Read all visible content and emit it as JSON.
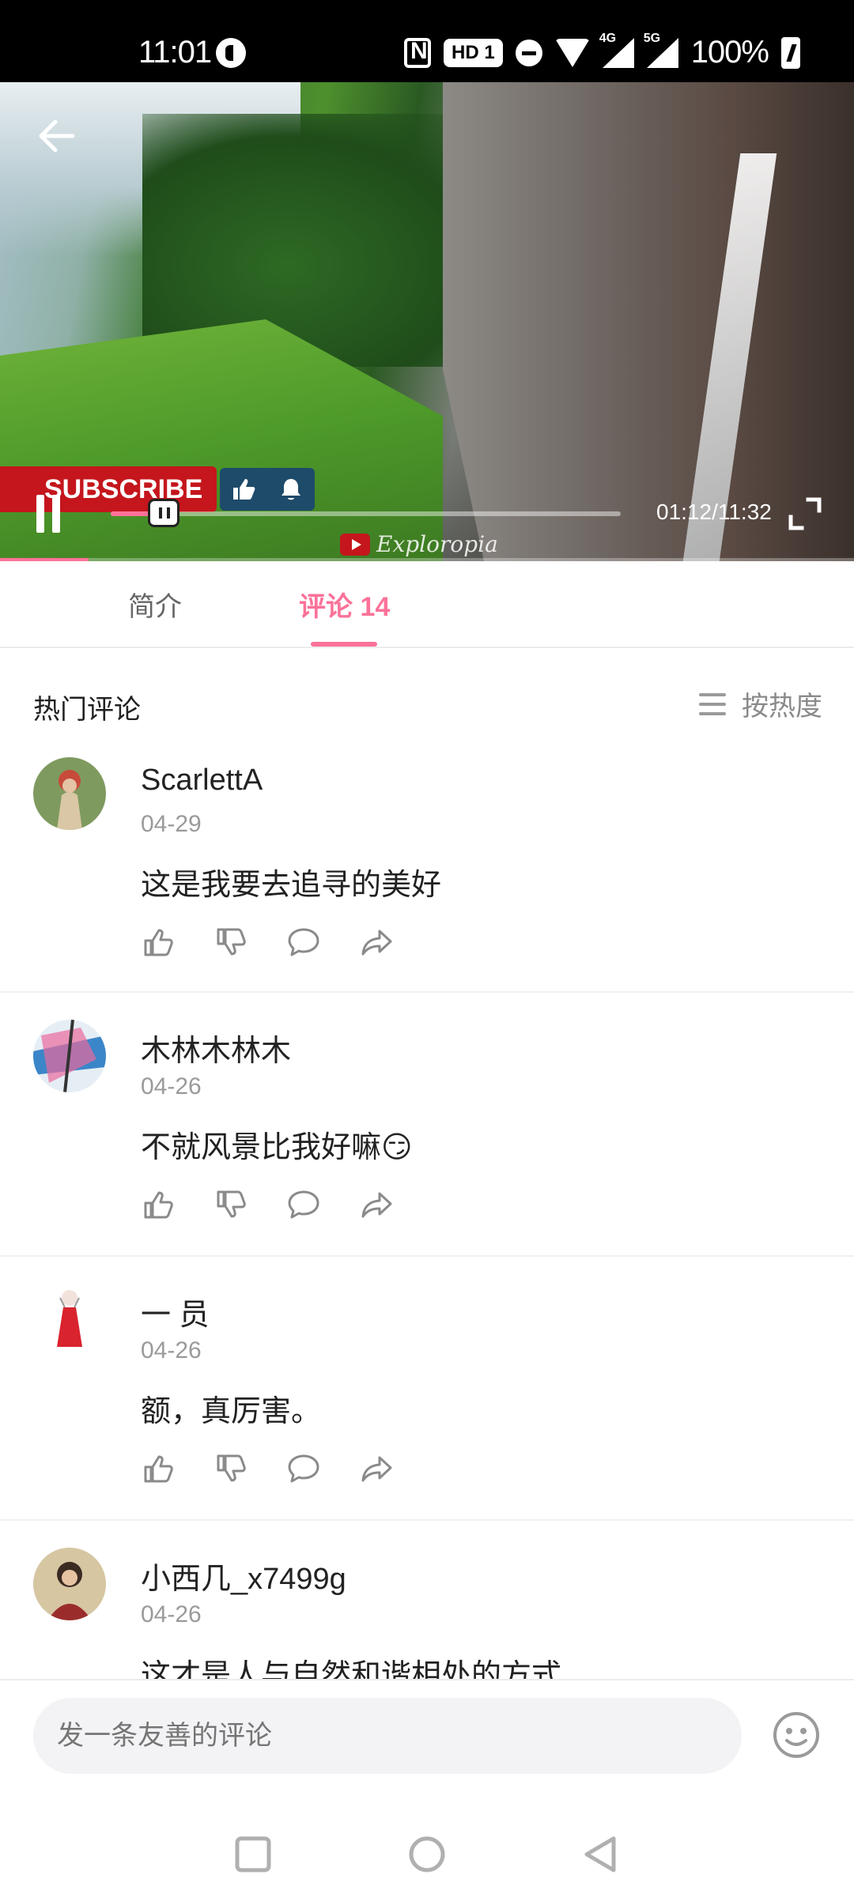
{
  "status_bar": {
    "time": "11:01",
    "hd_label": "HD 1",
    "net1": "4G",
    "net2": "5G",
    "battery": "100%"
  },
  "video": {
    "subscribe_label": "SUBSCRIBE",
    "time_display": "01:12/11:32",
    "watermark": "Exploropia",
    "progress_fraction": 0.104
  },
  "tabs": [
    {
      "label": "简介"
    },
    {
      "label": "评论 14"
    }
  ],
  "active_tab": 1,
  "comments_header": {
    "title": "热门评论",
    "sort_label": "按热度"
  },
  "comments": [
    {
      "name": "ScarlettA",
      "date": "04-29",
      "text": "这是我要去追寻的美好"
    },
    {
      "name": "木林木林木",
      "date": "04-26",
      "text": "不就风景比我好嘛😏"
    },
    {
      "name": "一 员",
      "date": "04-26",
      "text": "额，真厉害。"
    },
    {
      "name": "小西几_x7499g",
      "date": "04-26",
      "text": "这才是人与自然和谐相处的方式"
    }
  ],
  "input": {
    "placeholder": "发一条友善的评论"
  },
  "colors": {
    "accent": "#fb7299",
    "status_bar_bg": "#000000"
  },
  "icons": [
    "back-arrow-icon",
    "pause-icon",
    "fullscreen-icon",
    "sort-list-icon",
    "like-icon",
    "dislike-icon",
    "reply-icon",
    "share-icon",
    "emoji-icon",
    "nav-recents-icon",
    "nav-home-icon",
    "nav-back-icon"
  ]
}
